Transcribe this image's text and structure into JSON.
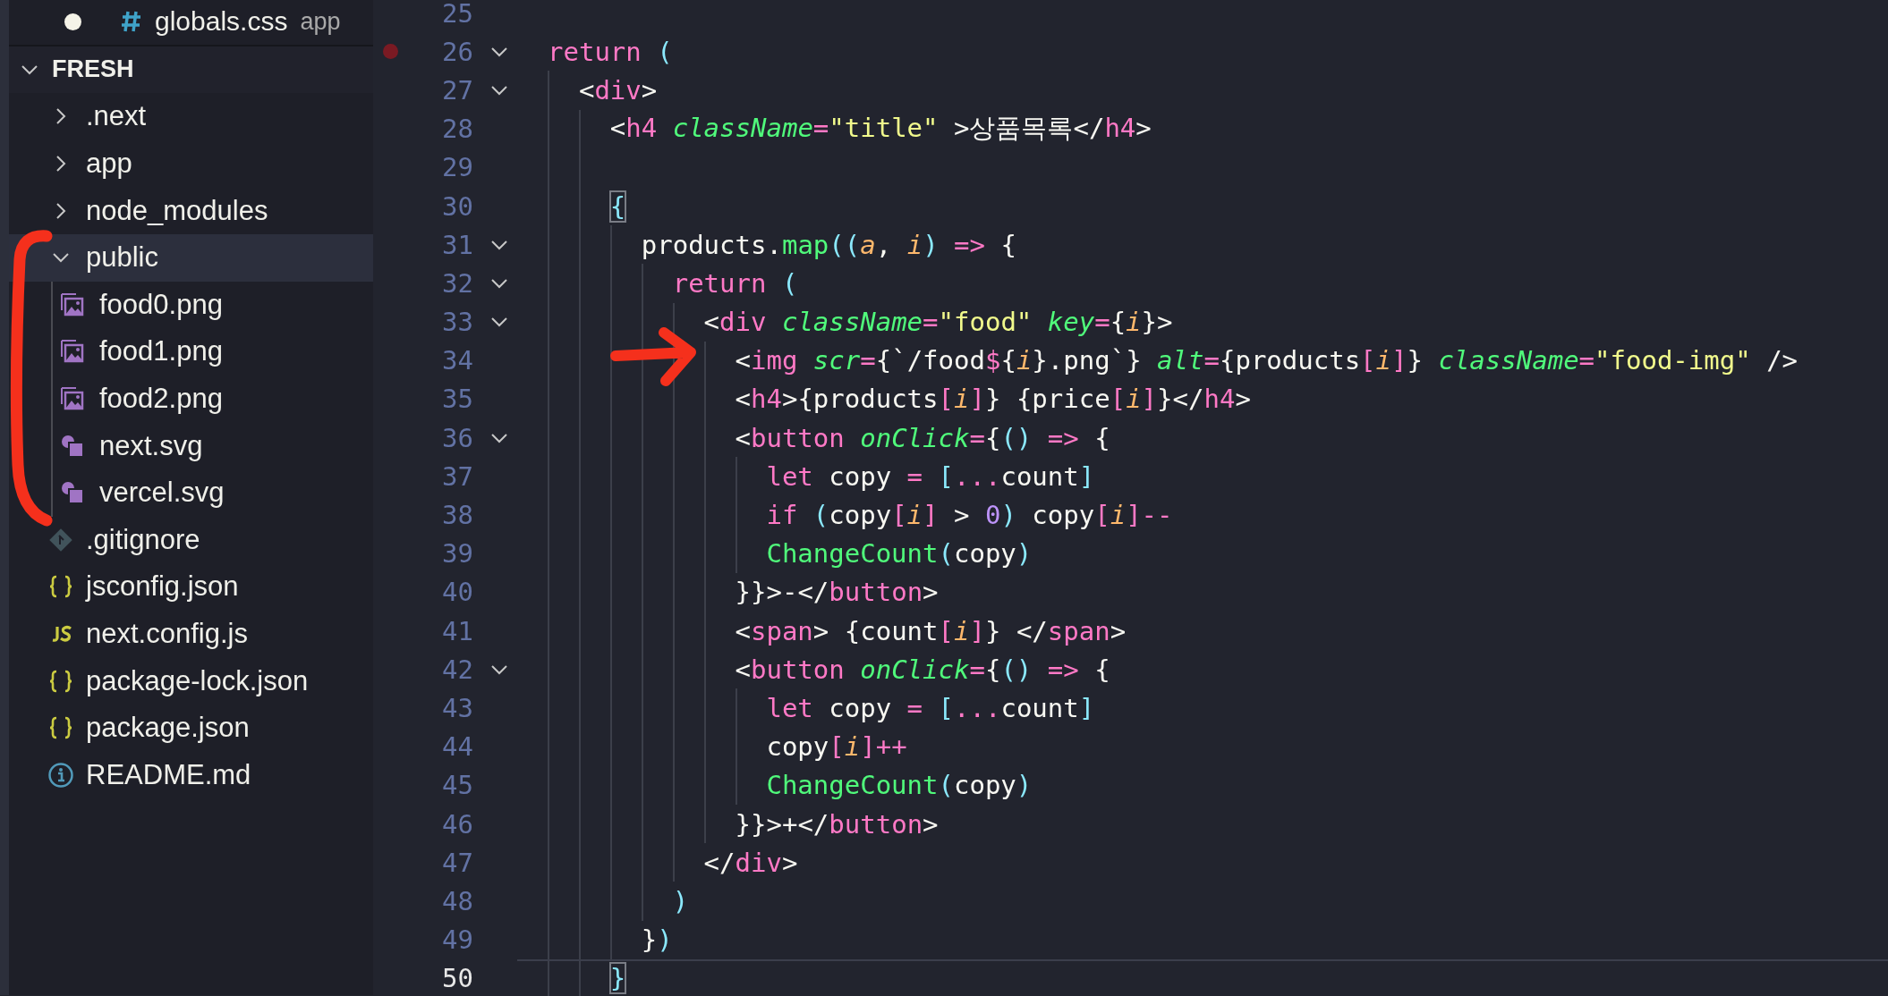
{
  "open_editors": [
    {
      "name": "globals.css",
      "description": "app",
      "kind": "css",
      "dirty": true
    }
  ],
  "explorer": {
    "title": "FRESH",
    "expanded": true,
    "items": [
      {
        "name": ".next",
        "kind": "folder",
        "expanded": false,
        "selected": false
      },
      {
        "name": "app",
        "kind": "folder",
        "expanded": false,
        "selected": false
      },
      {
        "name": "node_modules",
        "kind": "folder",
        "expanded": false,
        "selected": false
      },
      {
        "name": "public",
        "kind": "folder",
        "expanded": true,
        "selected": true,
        "children": [
          {
            "name": "food0.png",
            "kind": "image",
            "selected": false
          },
          {
            "name": "food1.png",
            "kind": "image",
            "selected": false
          },
          {
            "name": "food2.png",
            "kind": "image",
            "selected": false
          },
          {
            "name": "next.svg",
            "kind": "svg",
            "selected": false
          },
          {
            "name": "vercel.svg",
            "kind": "svg",
            "selected": false
          }
        ]
      },
      {
        "name": ".gitignore",
        "kind": "git",
        "selected": false
      },
      {
        "name": "jsconfig.json",
        "kind": "json",
        "selected": false
      },
      {
        "name": "next.config.js",
        "kind": "js",
        "selected": false
      },
      {
        "name": "package-lock.json",
        "kind": "json",
        "selected": false
      },
      {
        "name": "package.json",
        "kind": "json",
        "selected": false
      },
      {
        "name": "README.md",
        "kind": "info",
        "selected": false
      }
    ]
  },
  "editor": {
    "lines": [
      {
        "number": "25",
        "breakpoint": false,
        "foldable": false,
        "current": false,
        "bracket_match": false
      },
      {
        "number": "26",
        "breakpoint": true,
        "foldable": true,
        "current": false,
        "bracket_match": false,
        "text": "return ("
      },
      {
        "number": "27",
        "breakpoint": false,
        "foldable": true,
        "current": false,
        "bracket_match": false,
        "text": "  <div>"
      },
      {
        "number": "28",
        "breakpoint": false,
        "foldable": false,
        "current": false,
        "bracket_match": false,
        "text": "    <h4 className=\"title\" >상품목록</h4>"
      },
      {
        "number": "29",
        "breakpoint": false,
        "foldable": false,
        "current": false,
        "bracket_match": false
      },
      {
        "number": "30",
        "breakpoint": false,
        "foldable": false,
        "current": false,
        "bracket_match": true,
        "text": "    {"
      },
      {
        "number": "31",
        "breakpoint": false,
        "foldable": true,
        "current": false,
        "bracket_match": false,
        "text": "      products.map((a, i) => {"
      },
      {
        "number": "32",
        "breakpoint": false,
        "foldable": true,
        "current": false,
        "bracket_match": false,
        "text": "        return ("
      },
      {
        "number": "33",
        "breakpoint": false,
        "foldable": true,
        "current": false,
        "bracket_match": false,
        "text": "          <div className=\"food\" key={i}>"
      },
      {
        "number": "34",
        "breakpoint": false,
        "foldable": false,
        "current": false,
        "bracket_match": false,
        "text": "            <img scr={`/food${i}.png`} alt={products[i]} className=\"food-img\" />"
      },
      {
        "number": "35",
        "breakpoint": false,
        "foldable": false,
        "current": false,
        "bracket_match": false,
        "text": "            <h4>{products[i]} {price[i]}</h4>"
      },
      {
        "number": "36",
        "breakpoint": false,
        "foldable": true,
        "current": false,
        "bracket_match": false,
        "text": "            <button onClick={() => {"
      },
      {
        "number": "37",
        "breakpoint": false,
        "foldable": false,
        "current": false,
        "bracket_match": false,
        "text": "              let copy = [...count]"
      },
      {
        "number": "38",
        "breakpoint": false,
        "foldable": false,
        "current": false,
        "bracket_match": false,
        "text": "              if (copy[i] > 0) copy[i]--"
      },
      {
        "number": "39",
        "breakpoint": false,
        "foldable": false,
        "current": false,
        "bracket_match": false,
        "text": "              ChangeCount(copy)"
      },
      {
        "number": "40",
        "breakpoint": false,
        "foldable": false,
        "current": false,
        "bracket_match": false,
        "text": "            }}>-</button>"
      },
      {
        "number": "41",
        "breakpoint": false,
        "foldable": false,
        "current": false,
        "bracket_match": false,
        "text": "            <span> {count[i]} </span>"
      },
      {
        "number": "42",
        "breakpoint": false,
        "foldable": true,
        "current": false,
        "bracket_match": false,
        "text": "            <button onClick={() => {"
      },
      {
        "number": "43",
        "breakpoint": false,
        "foldable": false,
        "current": false,
        "bracket_match": false,
        "text": "              let copy = [...count]"
      },
      {
        "number": "44",
        "breakpoint": false,
        "foldable": false,
        "current": false,
        "bracket_match": false,
        "text": "              copy[i]++"
      },
      {
        "number": "45",
        "breakpoint": false,
        "foldable": false,
        "current": false,
        "bracket_match": false,
        "text": "              ChangeCount(copy)"
      },
      {
        "number": "46",
        "breakpoint": false,
        "foldable": false,
        "current": false,
        "bracket_match": false,
        "text": "            }}>+</button>"
      },
      {
        "number": "47",
        "breakpoint": false,
        "foldable": false,
        "current": false,
        "bracket_match": false,
        "text": "          </div>"
      },
      {
        "number": "48",
        "breakpoint": false,
        "foldable": false,
        "current": false,
        "bracket_match": false,
        "text": "        )"
      },
      {
        "number": "49",
        "breakpoint": false,
        "foldable": false,
        "current": false,
        "bracket_match": false,
        "text": "      })"
      },
      {
        "number": "50",
        "breakpoint": false,
        "foldable": false,
        "current": true,
        "bracket_match": true,
        "text": "    }"
      }
    ]
  }
}
